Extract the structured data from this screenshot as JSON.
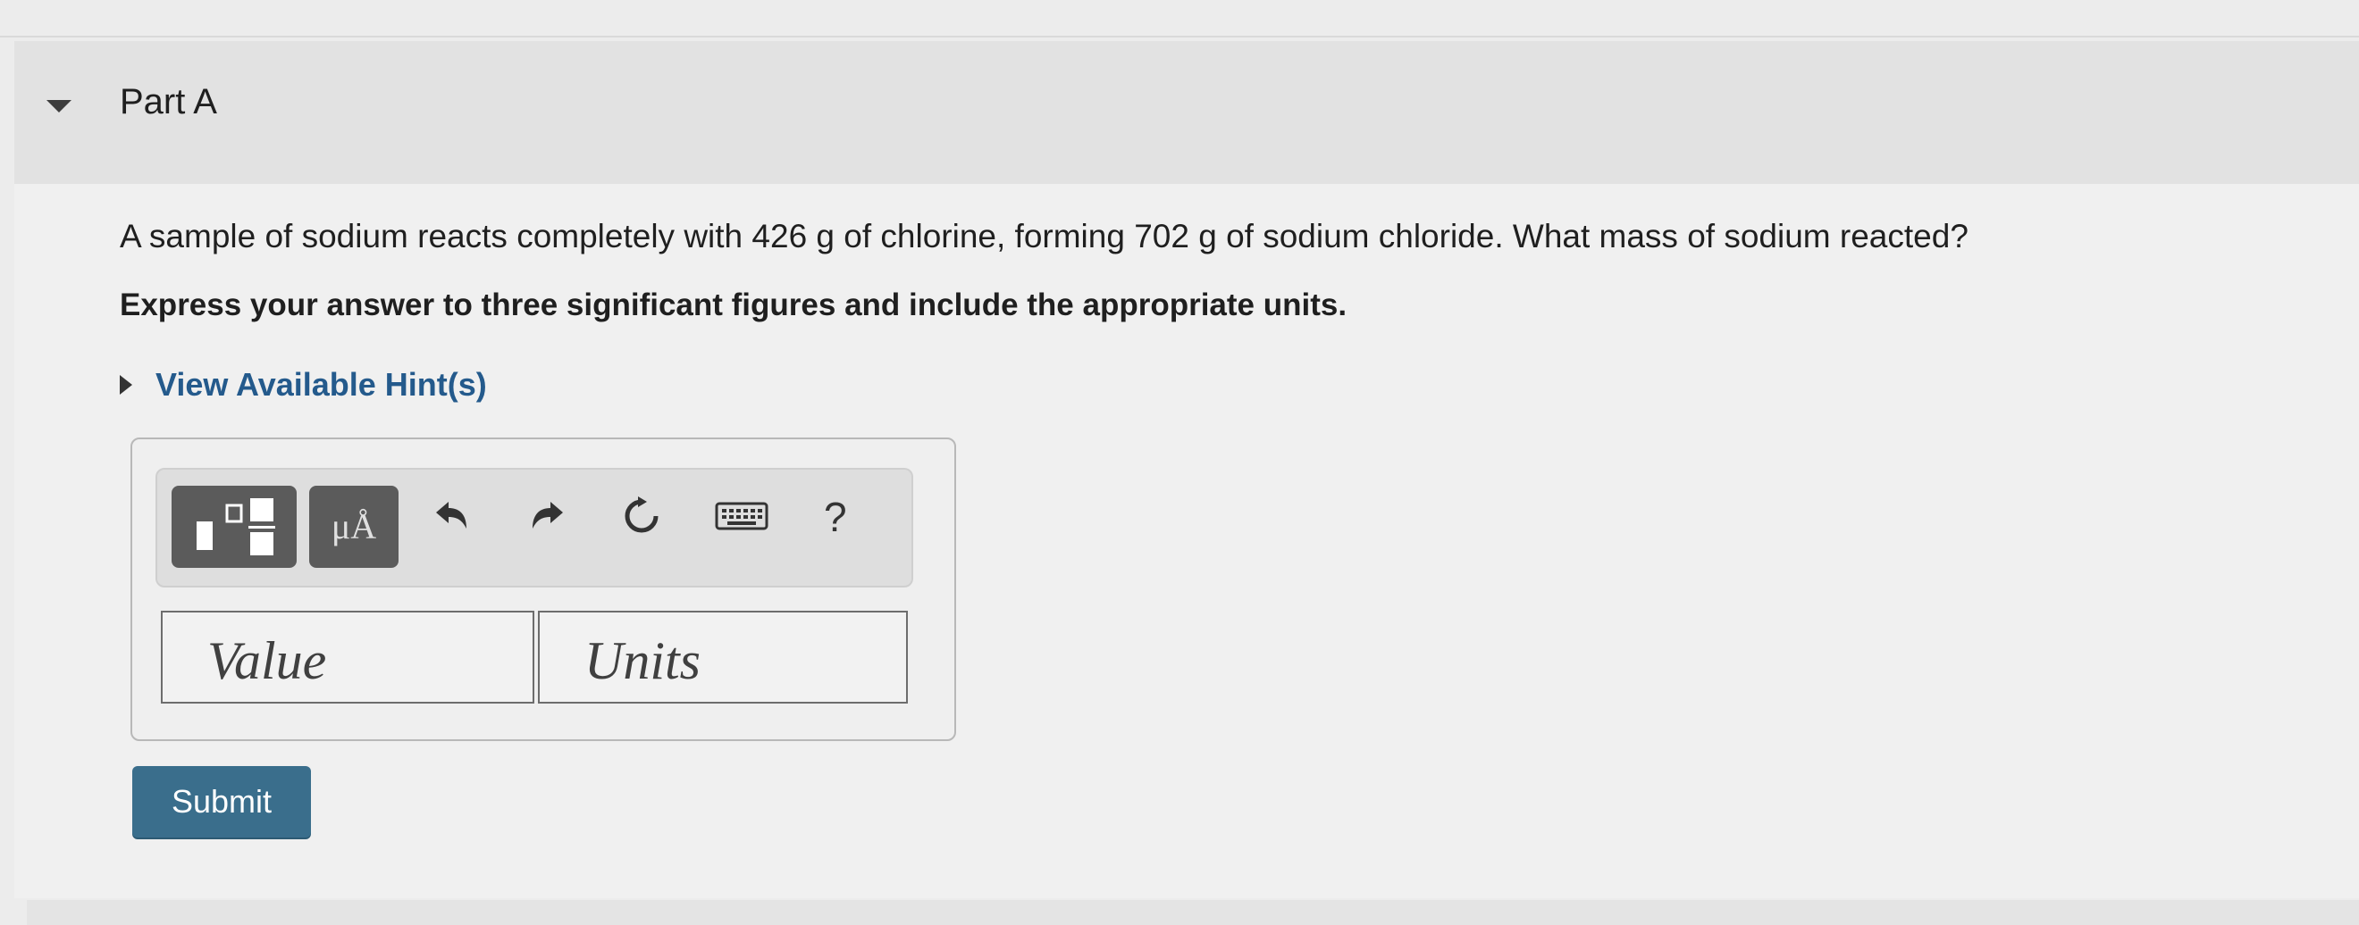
{
  "part": {
    "title": "Part A"
  },
  "question": {
    "text": "A sample of sodium reacts completely with 426 g of chlorine, forming 702 g of sodium chloride. What mass of sodium reacted?",
    "instructions": "Express your answer to three significant figures and include the appropriate units."
  },
  "hint": {
    "label": "View Available Hint(s)"
  },
  "toolbar": {
    "units_symbol": "μÅ",
    "help_label": "?"
  },
  "answer": {
    "value_placeholder": "Value",
    "units_placeholder": "Units"
  },
  "submit": {
    "label": "Submit"
  },
  "colors": {
    "accent": "#3a6e8c",
    "link": "#245a8c",
    "toolbar_button": "#5b5b5b"
  }
}
